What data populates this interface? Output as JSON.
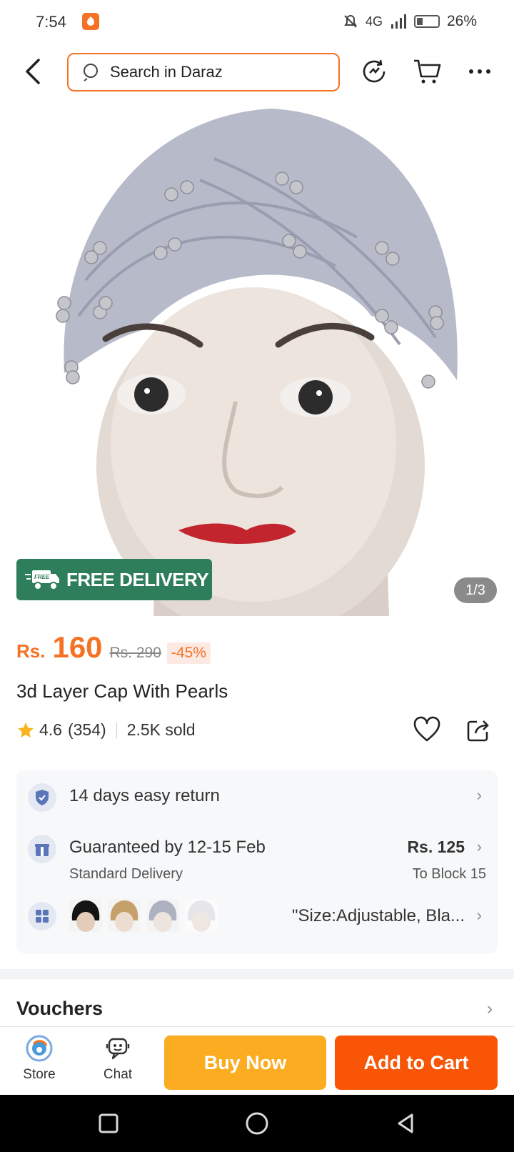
{
  "status_bar": {
    "time": "7:54",
    "network": "4G",
    "battery": "26%"
  },
  "search": {
    "placeholder": "Search in Daraz"
  },
  "icons": {
    "back": "chevron-left-icon",
    "search": "search-icon",
    "refresh": "refresh-icon",
    "cart": "cart-icon",
    "more": "more-icon",
    "heart": "heart-icon",
    "share": "share-icon"
  },
  "product": {
    "image_counter": "1/3",
    "free_delivery": "FREE DELIVERY",
    "free_tag": "FREE",
    "currency": "Rs.",
    "price": "160",
    "original_price": "Rs. 290",
    "discount": "-45%",
    "title": "3d Layer Cap With Pearls",
    "rating": "4.6",
    "reviews": "(354)",
    "sold": "2.5K sold"
  },
  "info": {
    "return_label": "14 days easy return",
    "delivery_label": "Guaranteed by 12-15 Feb",
    "delivery_sub": "Standard Delivery",
    "delivery_price": "Rs. 125",
    "delivery_to": "To Block 15",
    "variant_text": "\"Size:Adjustable, Bla..."
  },
  "vouchers": {
    "label": "Vouchers"
  },
  "bottom_bar": {
    "store_label": "Store",
    "chat_label": "Chat",
    "buy_now": "Buy Now",
    "add_to_cart": "Add to Cart"
  },
  "colors": {
    "accent": "#f57224",
    "buy_now": "#fbac20",
    "add_to_cart": "#f85606",
    "free_delivery": "#2e7d5b"
  }
}
